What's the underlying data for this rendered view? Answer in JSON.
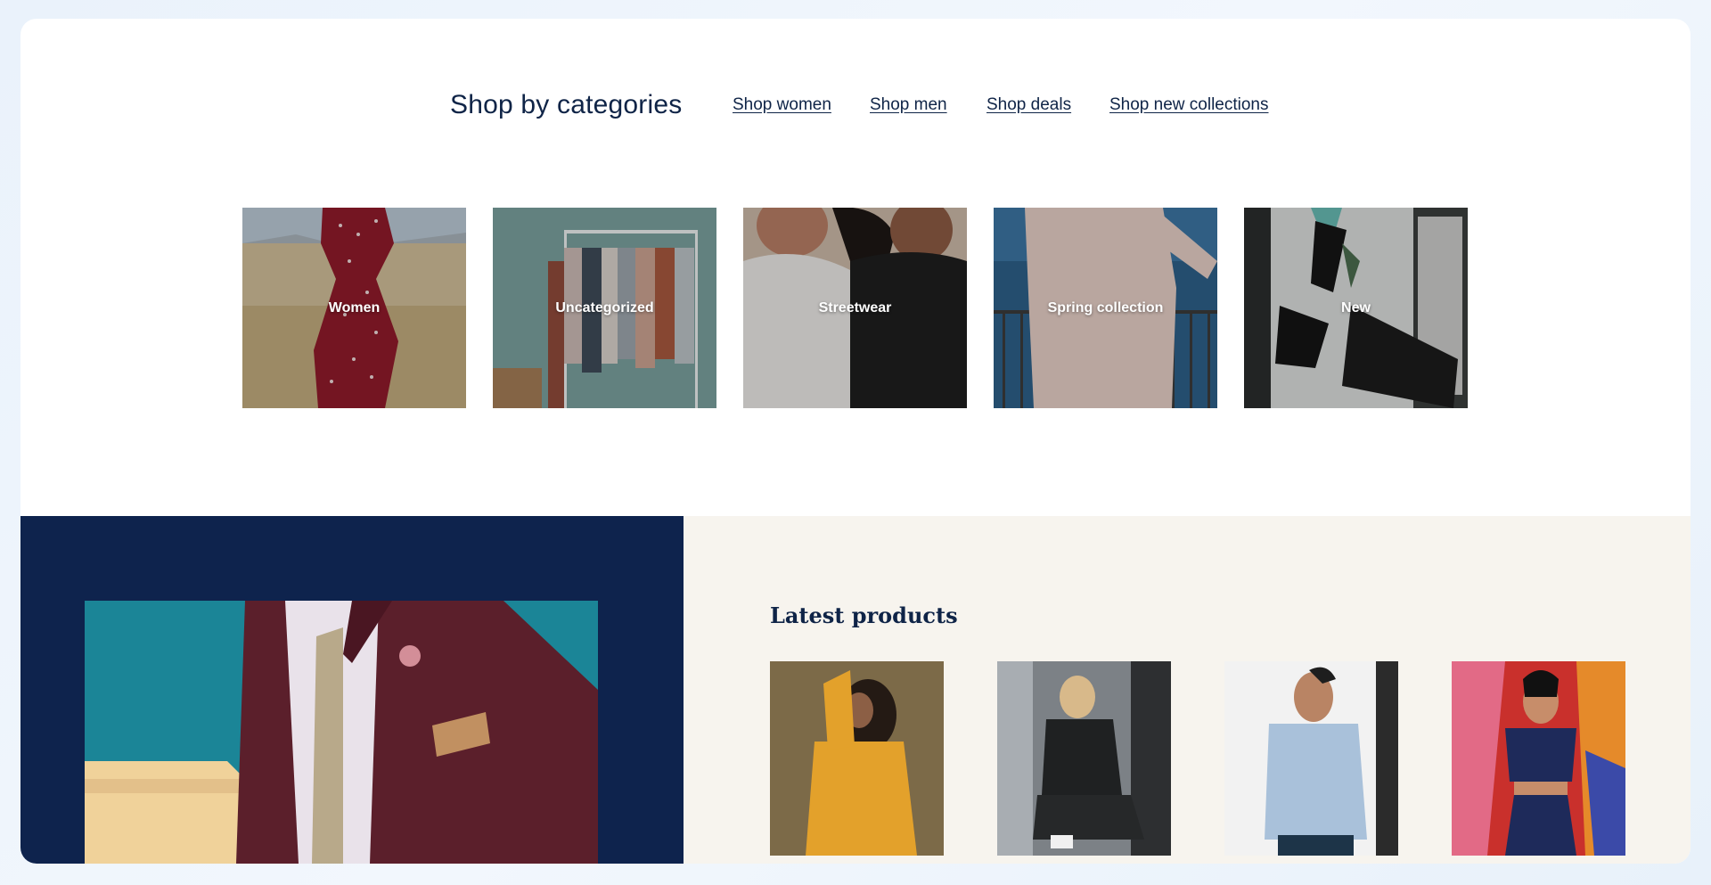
{
  "categories": {
    "title": "Shop by categories",
    "links": [
      {
        "label": "Shop women"
      },
      {
        "label": "Shop men"
      },
      {
        "label": "Shop deals"
      },
      {
        "label": "Shop new collections"
      }
    ],
    "tiles": [
      {
        "label": "Women"
      },
      {
        "label": "Uncategorized"
      },
      {
        "label": "Streetwear"
      },
      {
        "label": "Spring collection"
      },
      {
        "label": "New"
      }
    ]
  },
  "latest": {
    "title": "Latest products"
  },
  "colors": {
    "navy": "#0e234d",
    "text": "#0f2447",
    "beige": "#f7f4ee"
  }
}
